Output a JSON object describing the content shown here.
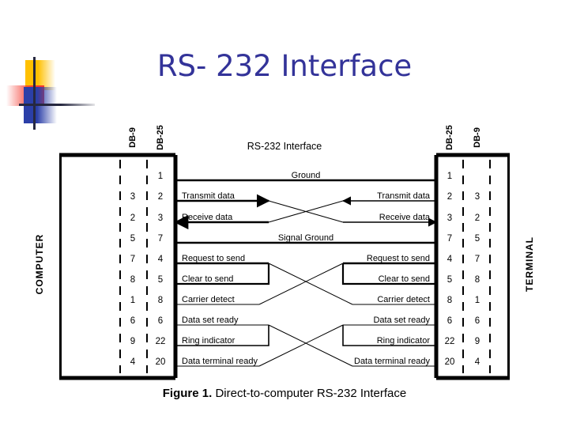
{
  "slide": {
    "title": "RS- 232 Interface",
    "title_color": "#333399",
    "logo": {
      "yellow": "#FFC000",
      "red": "#F4392F",
      "blue": "#2B3FA8",
      "line": "#262840"
    }
  },
  "figure": {
    "diagram_title": "RS-232 Interface",
    "left_side_label": "COMPUTER",
    "right_side_label": "TERMINAL",
    "left_headers": [
      "DB-9",
      "DB-25"
    ],
    "right_headers": [
      "DB-25",
      "DB-9"
    ],
    "caption_prefix": "Figure 1.",
    "caption_text": "Direct-to-computer RS-232 Interface",
    "rows": [
      {
        "signal": "Ground",
        "left_label": "",
        "right_label": "",
        "left_db9": "",
        "left_db25": "1",
        "right_db25": "1",
        "right_db9": ""
      },
      {
        "signal": "Transmit data",
        "left_label": "Transmit data",
        "right_label": "Transmit data",
        "left_db9": "3",
        "left_db25": "2",
        "right_db25": "2",
        "right_db9": "3"
      },
      {
        "signal": "Receive data",
        "left_label": "Receive data",
        "right_label": "Receive data",
        "left_db9": "2",
        "left_db25": "3",
        "right_db25": "3",
        "right_db9": "2"
      },
      {
        "signal": "Signal Ground",
        "left_label": "",
        "right_label": "",
        "left_db9": "5",
        "left_db25": "7",
        "right_db25": "7",
        "right_db9": "5"
      },
      {
        "signal": "Request to send",
        "left_label": "Request to send",
        "right_label": "Request to send",
        "left_db9": "7",
        "left_db25": "4",
        "right_db25": "4",
        "right_db9": "7"
      },
      {
        "signal": "Clear to send",
        "left_label": "Clear to send",
        "right_label": "Clear to send",
        "left_db9": "8",
        "left_db25": "5",
        "right_db25": "5",
        "right_db9": "8"
      },
      {
        "signal": "Carrier detect",
        "left_label": "Carrier detect",
        "right_label": "Carrier detect",
        "left_db9": "1",
        "left_db25": "8",
        "right_db25": "8",
        "right_db9": "1"
      },
      {
        "signal": "Data set ready",
        "left_label": "Data set ready",
        "right_label": "Data set ready",
        "left_db9": "6",
        "left_db25": "6",
        "right_db25": "6",
        "right_db9": "6"
      },
      {
        "signal": "Ring indicator",
        "left_label": "Ring indicator",
        "right_label": "Ring indicator",
        "left_db9": "9",
        "left_db25": "22",
        "right_db25": "22",
        "right_db9": "9"
      },
      {
        "signal": "Data terminal ready",
        "left_label": "Data terminal ready",
        "right_label": "Data terminal ready",
        "left_db9": "4",
        "left_db25": "20",
        "right_db25": "20",
        "right_db9": "4"
      }
    ]
  }
}
